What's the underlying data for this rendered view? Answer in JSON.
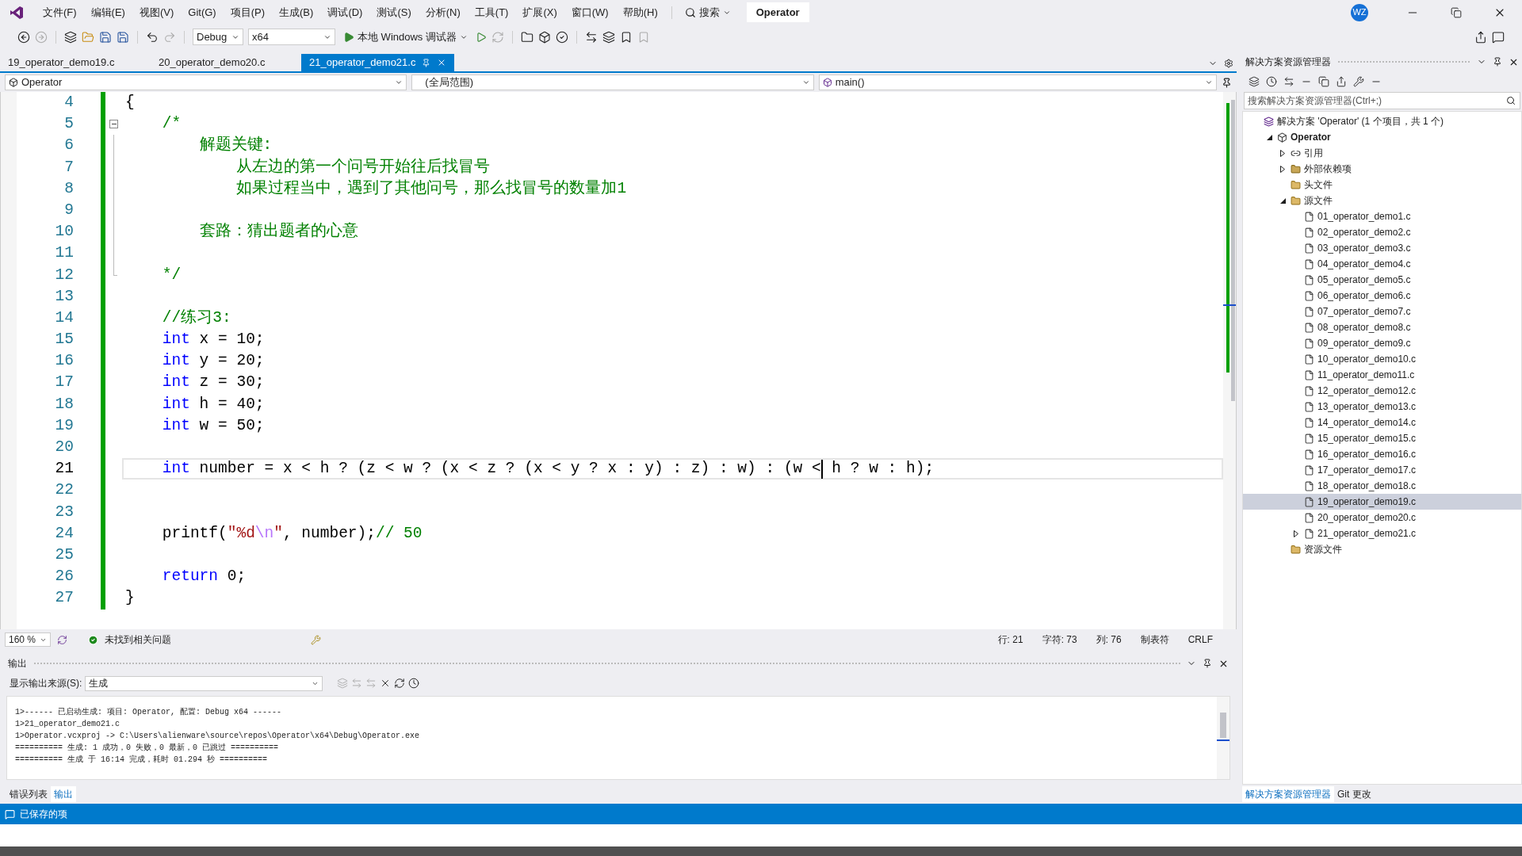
{
  "menu": {
    "items": [
      "文件(F)",
      "编辑(E)",
      "视图(V)",
      "Git(G)",
      "项目(P)",
      "生成(B)",
      "调试(D)",
      "测试(S)",
      "分析(N)",
      "工具(T)",
      "扩展(X)",
      "窗口(W)",
      "帮助(H)"
    ],
    "search": "搜索",
    "title": "Operator",
    "avatar": "WZ"
  },
  "toolbar": {
    "configuration": "Debug",
    "platform": "x64",
    "run": "本地 Windows 调试器"
  },
  "tabs": [
    {
      "label": "19_operator_demo19.c",
      "selected": false
    },
    {
      "label": "20_operator_demo20.c",
      "selected": false
    },
    {
      "label": "21_operator_demo21.c",
      "selected": true
    }
  ],
  "navigation": {
    "project": "Operator",
    "scope": "(全局范围)",
    "member": "main()"
  },
  "editor": {
    "region_expanded": true,
    "lines": [
      {
        "number": "4",
        "current": false,
        "tokens": [
          {
            "kind": "plain",
            "text": "{"
          }
        ]
      },
      {
        "number": "5",
        "current": false,
        "in_region": true,
        "tokens": [
          {
            "kind": "comment",
            "text": "    /*"
          }
        ]
      },
      {
        "number": "6",
        "current": false,
        "in_region": true,
        "tokens": [
          {
            "kind": "comment",
            "text": "        解题关键:"
          }
        ]
      },
      {
        "number": "7",
        "current": false,
        "in_region": true,
        "tokens": [
          {
            "kind": "comment",
            "text": "            从左边的第一个问号开始往后找冒号"
          }
        ]
      },
      {
        "number": "8",
        "current": false,
        "in_region": true,
        "tokens": [
          {
            "kind": "comment",
            "text": "            如果过程当中，遇到了其他问号，那么找冒号的数量加1"
          }
        ]
      },
      {
        "number": "9",
        "current": false,
        "in_region": true
      },
      {
        "number": "10",
        "current": false,
        "in_region": true,
        "tokens": [
          {
            "kind": "comment",
            "text": "        套路：猜出题者的心意"
          }
        ]
      },
      {
        "number": "11",
        "current": false,
        "in_region": true
      },
      {
        "number": "12",
        "current": false,
        "in_region": true,
        "tokens": [
          {
            "kind": "comment",
            "text": "    */"
          }
        ]
      },
      {
        "number": "13",
        "current": false
      },
      {
        "number": "14",
        "current": false,
        "tokens": [
          {
            "kind": "comment",
            "text": "    //练习3:"
          }
        ]
      },
      {
        "number": "15",
        "current": false,
        "tokens": [
          {
            "kind": "keyword",
            "text": "    int"
          },
          {
            "kind": "plain",
            "text": " x = 10;"
          }
        ]
      },
      {
        "number": "16",
        "current": false,
        "tokens": [
          {
            "kind": "keyword",
            "text": "    int"
          },
          {
            "kind": "plain",
            "text": " y = 20;"
          }
        ]
      },
      {
        "number": "17",
        "current": false,
        "tokens": [
          {
            "kind": "keyword",
            "text": "    int"
          },
          {
            "kind": "plain",
            "text": " z = 30;"
          }
        ]
      },
      {
        "number": "18",
        "current": false,
        "tokens": [
          {
            "kind": "keyword",
            "text": "    int"
          },
          {
            "kind": "plain",
            "text": " h = 40;"
          }
        ]
      },
      {
        "number": "19",
        "current": false,
        "tokens": [
          {
            "kind": "keyword",
            "text": "    int"
          },
          {
            "kind": "plain",
            "text": " w = 50;"
          }
        ]
      },
      {
        "number": "20",
        "current": false
      },
      {
        "number": "21",
        "current": true,
        "tokens": [
          {
            "kind": "keyword",
            "text": "    int"
          },
          {
            "kind": "plain",
            "text": " number = x < h ? (z < w ? (x < z ? (x < y ? x : y) : z) : w) : (w <"
          },
          {
            "kind": "caret"
          },
          {
            "kind": "plain",
            "text": " h ? w : h);"
          }
        ]
      },
      {
        "number": "22",
        "current": false
      },
      {
        "number": "23",
        "current": false
      },
      {
        "number": "24",
        "current": false,
        "tokens": [
          {
            "kind": "plain",
            "text": "    printf("
          },
          {
            "kind": "string",
            "text": "\"%d"
          },
          {
            "kind": "escape",
            "text": "\\n"
          },
          {
            "kind": "string",
            "text": "\""
          },
          {
            "kind": "plain",
            "text": ", number);"
          },
          {
            "kind": "comment",
            "text": "// 50"
          }
        ]
      },
      {
        "number": "25",
        "current": false
      },
      {
        "number": "26",
        "current": false,
        "tokens": [
          {
            "kind": "keyword",
            "text": "    return"
          },
          {
            "kind": "plain",
            "text": " 0;"
          }
        ]
      },
      {
        "number": "27",
        "current": false,
        "tokens": [
          {
            "kind": "plain",
            "text": "}"
          }
        ]
      }
    ]
  },
  "editor_status": {
    "zoom": "160 %",
    "issues": "未找到相关问题",
    "line": "行: 21",
    "char": "字符: 73",
    "column": "列: 76",
    "indent": "制表符",
    "line_ending": "CRLF"
  },
  "output": {
    "title": "输出",
    "source_label": "显示输出来源(S):",
    "source": "生成",
    "lines": [
      "1>------ 已启动生成: 项目: Operator, 配置: Debug x64 ------",
      "1>21_operator_demo21.c",
      "1>Operator.vcxproj -> C:\\Users\\alienware\\source\\repos\\Operator\\x64\\Debug\\Operator.exe",
      "========== 生成: 1 成功，0 失败，0 最新，0 已跳过 ==========",
      "========== 生成 于 16:14 完成，耗时 01.294 秒 =========="
    ]
  },
  "bottom_tabs": [
    {
      "label": "错误列表",
      "selected": false
    },
    {
      "label": "输出",
      "selected": true
    }
  ],
  "solution_explorer": {
    "title": "解决方案资源管理器",
    "search": {
      "placeholder": "搜索解决方案资源管理器(Ctrl+;)"
    },
    "tree": [
      {
        "kind": "solution",
        "label": "解决方案 'Operator' (1 个项目，共 1 个)",
        "selected": false,
        "children": [
          {
            "kind": "project",
            "label": "Operator",
            "expanded": true,
            "selected": false,
            "children": [
              {
                "kind": "references",
                "label": "引用",
                "expanded": false,
                "selected": false
              },
              {
                "kind": "dependencies",
                "label": "外部依赖项",
                "expanded": false,
                "selected": false
              },
              {
                "kind": "filter",
                "label": "头文件",
                "selected": false
              },
              {
                "kind": "filter",
                "label": "源文件",
                "expanded": true,
                "selected": false,
                "children": [
                  {
                    "kind": "file",
                    "label": "01_operator_demo1.c",
                    "selected": false
                  },
                  {
                    "kind": "file",
                    "label": "02_operator_demo2.c",
                    "selected": false
                  },
                  {
                    "kind": "file",
                    "label": "03_operator_demo3.c",
                    "selected": false
                  },
                  {
                    "kind": "file",
                    "label": "04_operator_demo4.c",
                    "selected": false
                  },
                  {
                    "kind": "file",
                    "label": "05_operator_demo5.c",
                    "selected": false
                  },
                  {
                    "kind": "file",
                    "label": "06_operator_demo6.c",
                    "selected": false
                  },
                  {
                    "kind": "file",
                    "label": "07_operator_demo7.c",
                    "selected": false
                  },
                  {
                    "kind": "file",
                    "label": "08_operator_demo8.c",
                    "selected": false
                  },
                  {
                    "kind": "file",
                    "label": "09_operator_demo9.c",
                    "selected": false
                  },
                  {
                    "kind": "file",
                    "label": "10_operator_demo10.c",
                    "selected": false
                  },
                  {
                    "kind": "file",
                    "label": "11_operator_demo11.c",
                    "selected": false
                  },
                  {
                    "kind": "file",
                    "label": "12_operator_demo12.c",
                    "selected": false
                  },
                  {
                    "kind": "file",
                    "label": "13_operator_demo13.c",
                    "selected": false
                  },
                  {
                    "kind": "file",
                    "label": "14_operator_demo14.c",
                    "selected": false
                  },
                  {
                    "kind": "file",
                    "label": "15_operator_demo15.c",
                    "selected": false
                  },
                  {
                    "kind": "file",
                    "label": "16_operator_demo16.c",
                    "selected": false
                  },
                  {
                    "kind": "file",
                    "label": "17_operator_demo17.c",
                    "selected": false
                  },
                  {
                    "kind": "file",
                    "label": "18_operator_demo18.c",
                    "selected": false
                  },
                  {
                    "kind": "file",
                    "label": "19_operator_demo19.c",
                    "selected": true
                  },
                  {
                    "kind": "file",
                    "label": "20_operator_demo20.c",
                    "selected": false
                  },
                  {
                    "kind": "file",
                    "label": "21_operator_demo21.c",
                    "expanded": false,
                    "selected": false
                  }
                ]
              },
              {
                "kind": "filter",
                "label": "资源文件",
                "selected": false
              }
            ]
          }
        ]
      }
    ],
    "tabs": [
      {
        "label": "解决方案资源管理器",
        "selected": true
      },
      {
        "label": "Git 更改",
        "selected": false
      }
    ]
  },
  "status_bar": {
    "message": "已保存的项"
  }
}
